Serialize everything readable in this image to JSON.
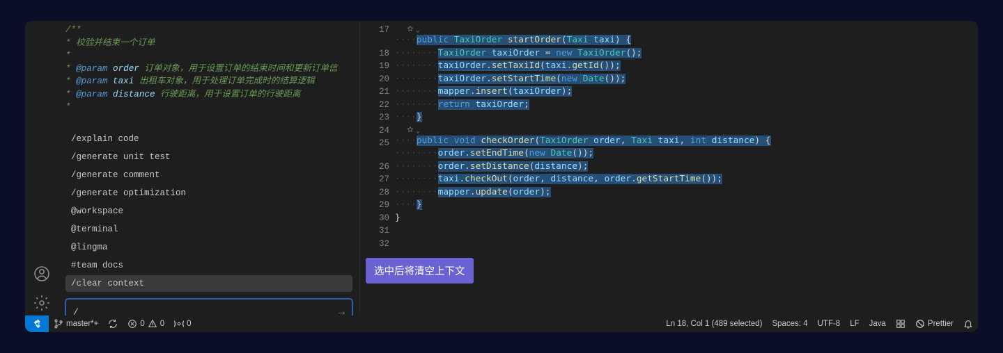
{
  "comments": {
    "l1": "/**",
    "l2": " * 校验并结束一个订单",
    "l3": " *",
    "l4": " * ",
    "p4": "@param",
    "n4": "order",
    "d4": " 订单对象，用于设置订单的结束时间和更新订单信",
    "l5": " * ",
    "p5": "@param",
    "n5": "taxi",
    "d5": " 出租车对象，用于处理订单完成时的结算逻辑",
    "l6": " * ",
    "p6": "@param",
    "n6": "distance",
    "d6": " 行驶距离，用于设置订单的行驶距离",
    "l7": " *"
  },
  "suggestions": [
    "/explain code",
    "/generate unit test",
    "/generate comment",
    "/generate optimization",
    "@workspace",
    "@terminal",
    "@lingma",
    "#team docs",
    "/clear context"
  ],
  "input": {
    "value": "/"
  },
  "tooltip": "选中后将清空上下文",
  "lines": {
    "17": "",
    "18": {
      "ind": "····",
      "t": [
        [
          "kw",
          "public"
        ],
        [
          "pn",
          " "
        ],
        [
          "ty",
          "TaxiOrder"
        ],
        [
          "pn",
          " "
        ],
        [
          "fn",
          "startOrder"
        ],
        [
          "pn",
          "("
        ],
        [
          "ty",
          "Taxi"
        ],
        [
          "pn",
          " "
        ],
        [
          "vr",
          "taxi"
        ],
        [
          "pn",
          ") {"
        ]
      ]
    },
    "19": {
      "ind": "········",
      "t": [
        [
          "ty",
          "TaxiOrder"
        ],
        [
          "pn",
          " "
        ],
        [
          "vr",
          "taxiOrder"
        ],
        [
          "pn",
          " = "
        ],
        [
          "kw",
          "new"
        ],
        [
          "pn",
          " "
        ],
        [
          "ty",
          "TaxiOrder"
        ],
        [
          "pn",
          "();"
        ]
      ]
    },
    "20": {
      "ind": "········",
      "t": [
        [
          "vr",
          "taxiOrder"
        ],
        [
          "pn",
          "."
        ],
        [
          "fn",
          "setTaxiId"
        ],
        [
          "pn",
          "("
        ],
        [
          "vr",
          "taxi"
        ],
        [
          "pn",
          "."
        ],
        [
          "fn",
          "getId"
        ],
        [
          "pn",
          "());"
        ]
      ]
    },
    "21": {
      "ind": "········",
      "t": [
        [
          "vr",
          "taxiOrder"
        ],
        [
          "pn",
          "."
        ],
        [
          "fn",
          "setStartTime"
        ],
        [
          "pn",
          "("
        ],
        [
          "kw",
          "new"
        ],
        [
          "pn",
          " "
        ],
        [
          "ty",
          "Date"
        ],
        [
          "pn",
          "());"
        ]
      ]
    },
    "22": {
      "ind": "········",
      "t": [
        [
          "vr",
          "mapper"
        ],
        [
          "pn",
          "."
        ],
        [
          "fn",
          "insert"
        ],
        [
          "pn",
          "("
        ],
        [
          "vr",
          "taxiOrder"
        ],
        [
          "pn",
          ");"
        ]
      ]
    },
    "23": {
      "ind": "········",
      "t": [
        [
          "kw",
          "return"
        ],
        [
          "pn",
          " "
        ],
        [
          "vr",
          "taxiOrder"
        ],
        [
          "pn",
          ";"
        ]
      ]
    },
    "24": {
      "ind": "····",
      "t": [
        [
          "pn",
          "}"
        ]
      ]
    },
    "25": "",
    "26": {
      "ind": "····",
      "t": [
        [
          "kw",
          "public"
        ],
        [
          "pn",
          " "
        ],
        [
          "kw",
          "void"
        ],
        [
          "pn",
          " "
        ],
        [
          "fn",
          "checkOrder"
        ],
        [
          "pn",
          "("
        ],
        [
          "ty",
          "TaxiOrder"
        ],
        [
          "pn",
          " "
        ],
        [
          "vr",
          "order"
        ],
        [
          "pn",
          ", "
        ],
        [
          "ty",
          "Taxi"
        ],
        [
          "pn",
          " "
        ],
        [
          "vr",
          "taxi"
        ],
        [
          "pn",
          ", "
        ],
        [
          "kw",
          "int"
        ],
        [
          "pn",
          " "
        ],
        [
          "vr",
          "distance"
        ],
        [
          "pn",
          ") {"
        ]
      ]
    },
    "27": {
      "ind": "········",
      "t": [
        [
          "vr",
          "order"
        ],
        [
          "pn",
          "."
        ],
        [
          "fn",
          "setEndTime"
        ],
        [
          "pn",
          "("
        ],
        [
          "kw",
          "new"
        ],
        [
          "pn",
          " "
        ],
        [
          "ty",
          "Date"
        ],
        [
          "pn",
          "());"
        ]
      ]
    },
    "28": {
      "ind": "········",
      "t": [
        [
          "vr",
          "order"
        ],
        [
          "pn",
          "."
        ],
        [
          "fn",
          "setDistance"
        ],
        [
          "pn",
          "("
        ],
        [
          "vr",
          "distance"
        ],
        [
          "pn",
          ");"
        ]
      ]
    },
    "29": {
      "ind": "········",
      "t": [
        [
          "vr",
          "taxi"
        ],
        [
          "pn",
          "."
        ],
        [
          "fn",
          "checkOut"
        ],
        [
          "pn",
          "("
        ],
        [
          "vr",
          "order"
        ],
        [
          "pn",
          ", "
        ],
        [
          "vr",
          "distance"
        ],
        [
          "pn",
          ", "
        ],
        [
          "vr",
          "order"
        ],
        [
          "pn",
          "."
        ],
        [
          "fn",
          "getStartTime"
        ],
        [
          "pn",
          "());"
        ]
      ]
    },
    "30": {
      "ind": "········",
      "t": [
        [
          "vr",
          "mapper"
        ],
        [
          "pn",
          "."
        ],
        [
          "fn",
          "update"
        ],
        [
          "pn",
          "("
        ],
        [
          "vr",
          "order"
        ],
        [
          "pn",
          ");"
        ]
      ]
    },
    "31": {
      "ind": "····",
      "t": [
        [
          "pn",
          "}"
        ]
      ]
    },
    "32": {
      "ind": "",
      "t": [
        [
          "pn",
          "}"
        ]
      ],
      "nosel": true
    }
  },
  "status": {
    "branch": "master*+",
    "errors": "0",
    "warnings": "0",
    "port": "0",
    "selection": "Ln 18, Col 1 (489 selected)",
    "spaces": "Spaces: 4",
    "encoding": "UTF-8",
    "eol": "LF",
    "lang": "Java",
    "prettier": "Prettier"
  }
}
